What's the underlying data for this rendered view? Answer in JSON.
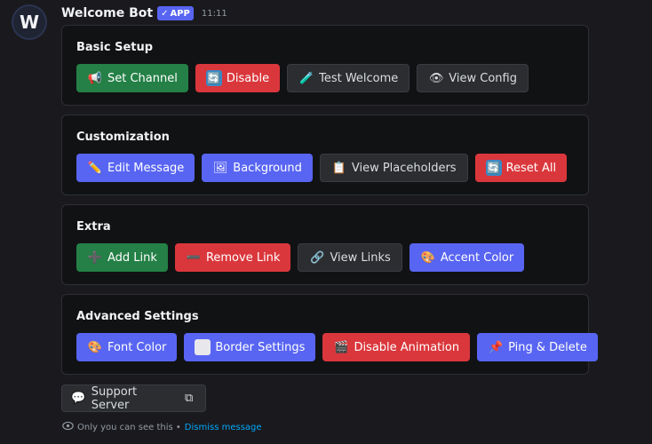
{
  "bot": {
    "avatar_letter": "W",
    "name": "Welcome Bot",
    "badge": "APP",
    "time": "11:11"
  },
  "sections": [
    {
      "title": "Basic Setup",
      "buttons": [
        {
          "label": "Set Channel",
          "icon": "📢",
          "style": "success"
        },
        {
          "label": "Disable",
          "icon": "🔄",
          "style": "danger"
        },
        {
          "label": "Test Welcome",
          "icon": "🧪",
          "style": "secondary"
        },
        {
          "label": "View Config",
          "icon": "👁",
          "style": "secondary"
        }
      ]
    },
    {
      "title": "Customization",
      "buttons": [
        {
          "label": "Edit Message",
          "icon": "✏️",
          "style": "primary"
        },
        {
          "label": "Background",
          "icon": "🖼",
          "style": "primary"
        },
        {
          "label": "View Placeholders",
          "icon": "📋",
          "style": "secondary"
        },
        {
          "label": "Reset All",
          "icon": "🔄",
          "style": "danger"
        }
      ]
    },
    {
      "title": "Extra",
      "buttons": [
        {
          "label": "Add Link",
          "icon": "➕",
          "style": "success"
        },
        {
          "label": "Remove Link",
          "icon": "➖",
          "style": "danger"
        },
        {
          "label": "View Links",
          "icon": "🔗",
          "style": "secondary"
        },
        {
          "label": "Accent Color",
          "icon": "🎨",
          "style": "primary"
        }
      ]
    },
    {
      "title": "Advanced Settings",
      "buttons": [
        {
          "label": "Font Color",
          "icon": "🎨",
          "style": "primary"
        },
        {
          "label": "Border Settings",
          "icon": "⬜",
          "style": "primary"
        },
        {
          "label": "Disable Animation",
          "icon": "🎬",
          "style": "danger"
        },
        {
          "label": "Ping & Delete",
          "icon": "📌",
          "style": "primary"
        }
      ]
    }
  ],
  "support": {
    "label": "Support Server",
    "icon": "💬",
    "external_icon": "⧉"
  },
  "footer": {
    "text": "Only you can see this •",
    "link": "Dismiss message"
  },
  "colors": {
    "success": "#248046",
    "danger": "#da373c",
    "primary": "#5865f2",
    "secondary": "#2b2d31"
  }
}
